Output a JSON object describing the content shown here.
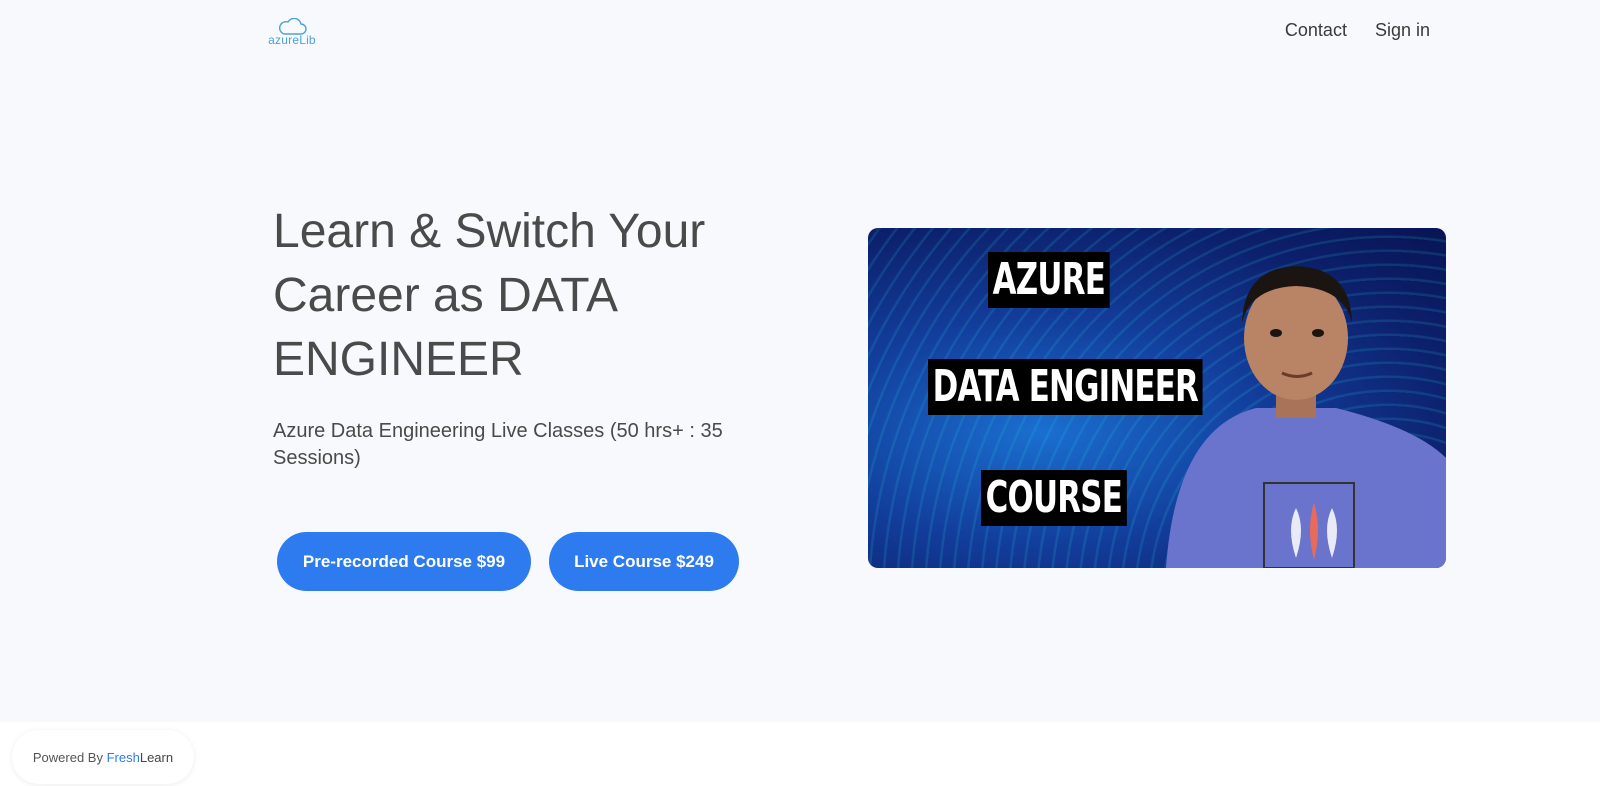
{
  "header": {
    "logo_text": "azureLib",
    "nav": [
      {
        "label": "Contact"
      },
      {
        "label": "Sign in"
      }
    ]
  },
  "hero": {
    "title": "Learn & Switch Your Career as DATA ENGINEER",
    "subtitle": "Azure Data Engineering Live Classes (50 hrs+ : 35 Sessions)",
    "buttons": [
      {
        "label": "Pre-recorded Course $99"
      },
      {
        "label": "Live Course $249"
      }
    ],
    "image_labels": [
      "AZURE",
      "DATA ENGINEER",
      "COURSE"
    ]
  },
  "footer": {
    "powered_prefix": "Powered By ",
    "brand_fresh": "Fresh",
    "brand_learn": "Learn"
  },
  "colors": {
    "accent": "#2d7bef",
    "background": "#f8f9fc",
    "logo": "#4aa3d8"
  }
}
